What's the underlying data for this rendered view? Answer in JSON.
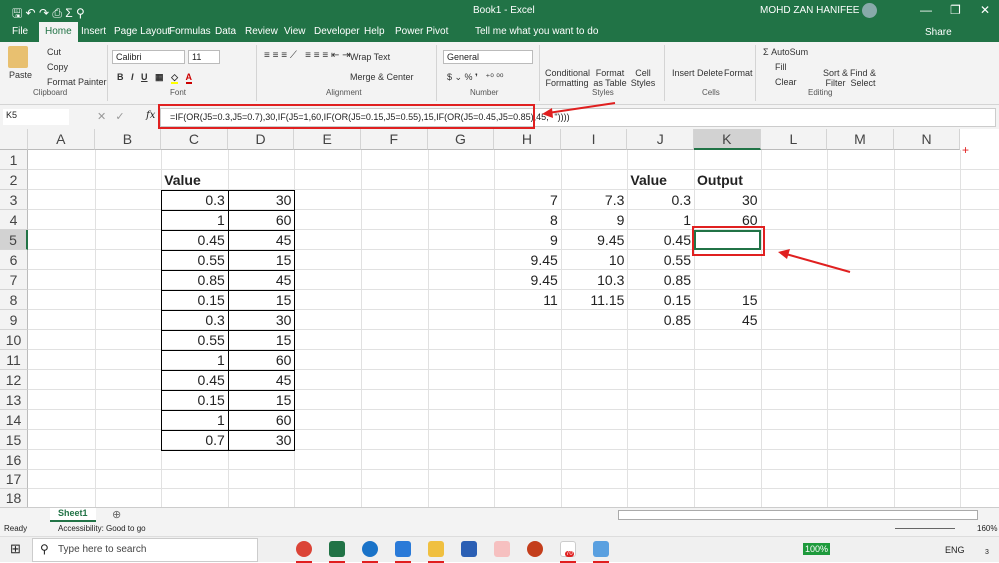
{
  "title": {
    "app": "Book1  -  Excel",
    "user": "MOHD ZAN HANIFEE",
    "share": "Share"
  },
  "tabs": [
    "File",
    "Home",
    "Insert",
    "Page Layout",
    "Formulas",
    "Data",
    "Review",
    "View",
    "Developer",
    "Help",
    "Power Pivot"
  ],
  "tell_me": "Tell me what you want to do",
  "ribbon": {
    "paste": "Paste",
    "cut": "Cut",
    "copy": "Copy",
    "format_painter": "Format Painter",
    "clipboard": "Clipboard",
    "font_name": "Calibri",
    "font_size": "11",
    "font": "Font",
    "wrap_text": "Wrap Text",
    "merge_center": "Merge & Center",
    "alignment": "Alignment",
    "number_format": "General",
    "number": "Number",
    "conditional_formatting": "Conditional Formatting",
    "format_as_table": "Format as Table",
    "cell_styles": "Cell Styles",
    "styles": "Styles",
    "insert": "Insert",
    "delete": "Delete",
    "format": "Format",
    "cells": "Cells",
    "autosum": "AutoSum",
    "fill": "Fill",
    "clear": "Clear",
    "sort_filter": "Sort & Filter",
    "find_select": "Find & Select",
    "editing": "Editing"
  },
  "formula_bar": {
    "name_box": "K5",
    "fx": "fx",
    "formula": "=IF(OR(J5=0.3,J5=0.7),30,IF(J5=1,60,IF(OR(J5=0.15,J5=0.55),15,IF(OR(J5=0.45,J5=0.85),45,\" \"))))"
  },
  "columns": [
    "A",
    "B",
    "C",
    "D",
    "E",
    "F",
    "G",
    "H",
    "I",
    "J",
    "K",
    "L",
    "M",
    "N"
  ],
  "rows": [
    "1",
    "2",
    "3",
    "4",
    "5",
    "6",
    "7",
    "8",
    "9",
    "10",
    "11",
    "12",
    "13",
    "14",
    "15",
    "16",
    "17",
    "18"
  ],
  "cells": [
    {
      "ref": "C2",
      "v": "Value",
      "bold": true
    },
    {
      "ref": "C3",
      "v": "0.3"
    },
    {
      "ref": "D3",
      "v": "30"
    },
    {
      "ref": "C4",
      "v": "1"
    },
    {
      "ref": "D4",
      "v": "60"
    },
    {
      "ref": "C5",
      "v": "0.45"
    },
    {
      "ref": "D5",
      "v": "45"
    },
    {
      "ref": "C6",
      "v": "0.55"
    },
    {
      "ref": "D6",
      "v": "15"
    },
    {
      "ref": "C7",
      "v": "0.85"
    },
    {
      "ref": "D7",
      "v": "45"
    },
    {
      "ref": "C8",
      "v": "0.15"
    },
    {
      "ref": "D8",
      "v": "15"
    },
    {
      "ref": "C9",
      "v": "0.3"
    },
    {
      "ref": "D9",
      "v": "30"
    },
    {
      "ref": "C10",
      "v": "0.55"
    },
    {
      "ref": "D10",
      "v": "15"
    },
    {
      "ref": "C11",
      "v": "1"
    },
    {
      "ref": "D11",
      "v": "60"
    },
    {
      "ref": "C12",
      "v": "0.45"
    },
    {
      "ref": "D12",
      "v": "45"
    },
    {
      "ref": "C13",
      "v": "0.15"
    },
    {
      "ref": "D13",
      "v": "15"
    },
    {
      "ref": "C14",
      "v": "1"
    },
    {
      "ref": "D14",
      "v": "60"
    },
    {
      "ref": "C15",
      "v": "0.7"
    },
    {
      "ref": "D15",
      "v": "30"
    },
    {
      "ref": "J2",
      "v": "Value",
      "bold": true
    },
    {
      "ref": "K2",
      "v": "Output",
      "bold": true
    },
    {
      "ref": "H3",
      "v": "7"
    },
    {
      "ref": "I3",
      "v": "7.3"
    },
    {
      "ref": "J3",
      "v": "0.3"
    },
    {
      "ref": "K3",
      "v": "30"
    },
    {
      "ref": "H4",
      "v": "8"
    },
    {
      "ref": "I4",
      "v": "9"
    },
    {
      "ref": "J4",
      "v": "1"
    },
    {
      "ref": "K4",
      "v": "60"
    },
    {
      "ref": "H5",
      "v": "9"
    },
    {
      "ref": "I5",
      "v": "9.45"
    },
    {
      "ref": "J5",
      "v": "0.45"
    },
    {
      "ref": "H6",
      "v": "9.45"
    },
    {
      "ref": "I6",
      "v": "10"
    },
    {
      "ref": "J6",
      "v": "0.55"
    },
    {
      "ref": "H7",
      "v": "9.45"
    },
    {
      "ref": "I7",
      "v": "10.3"
    },
    {
      "ref": "J7",
      "v": "0.85"
    },
    {
      "ref": "H8",
      "v": "11"
    },
    {
      "ref": "I8",
      "v": "11.15"
    },
    {
      "ref": "J8",
      "v": "0.15"
    },
    {
      "ref": "K8",
      "v": "15"
    },
    {
      "ref": "J9",
      "v": "0.85"
    },
    {
      "ref": "K9",
      "v": "45"
    }
  ],
  "sheet_tab": "Sheet1",
  "status": {
    "ready": "Ready",
    "accessibility": "Accessibility: Good to go",
    "zoom": "160%"
  },
  "taskbar": {
    "search": "Type here to search",
    "battery": "100%",
    "lang": "ENG",
    "mail_badge": "70",
    "notif": "3"
  },
  "colors": {
    "excel_green": "#217346",
    "annotation_red": "#e02020"
  }
}
